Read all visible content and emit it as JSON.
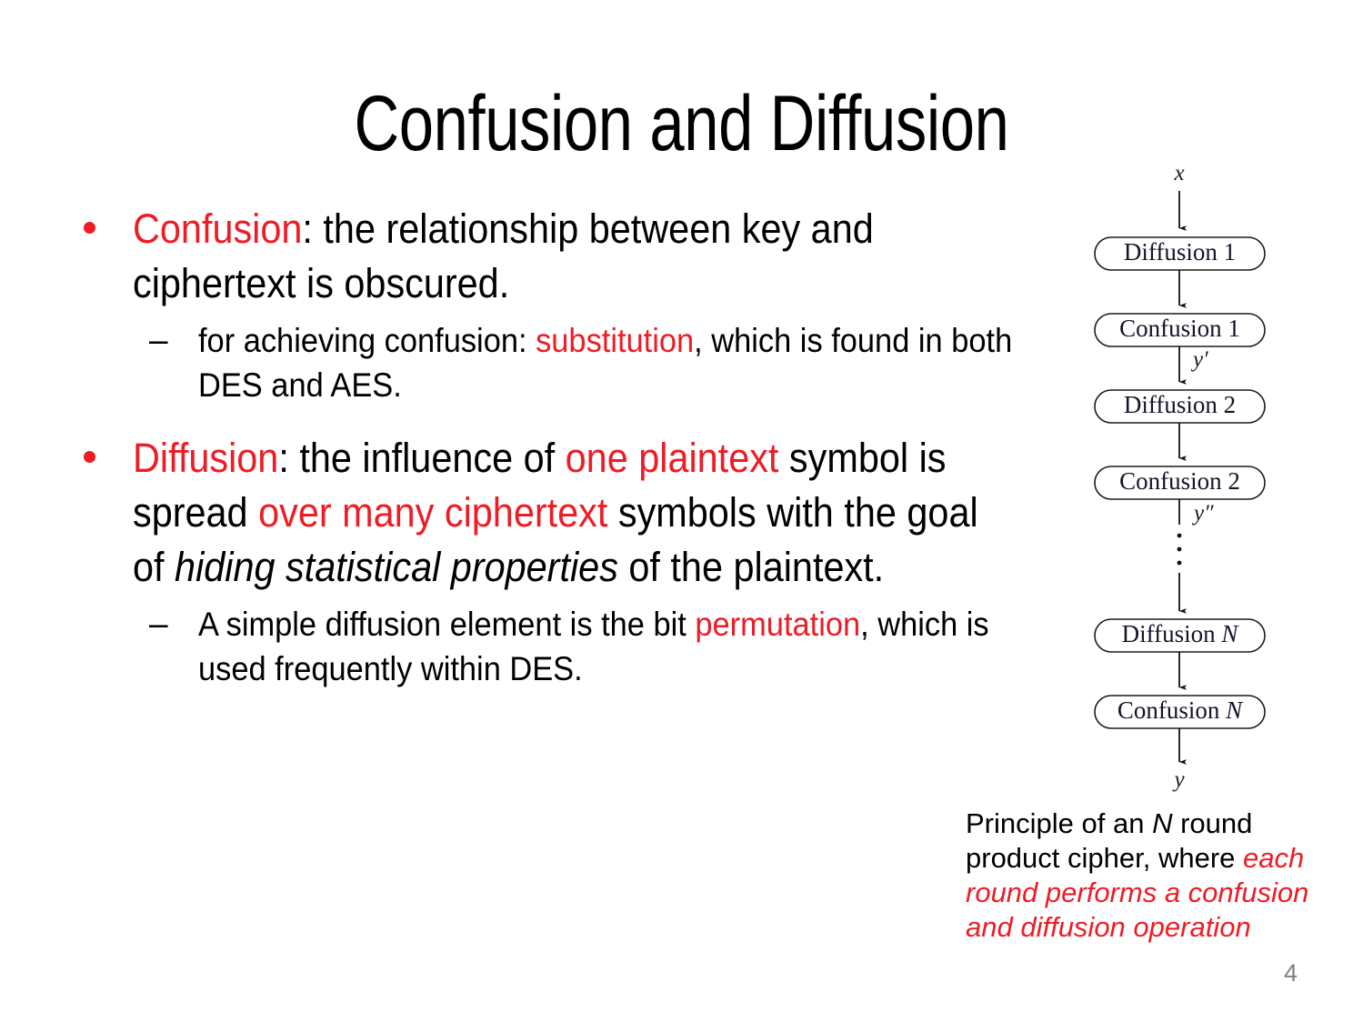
{
  "slide": {
    "title": "Confusion and Diffusion",
    "page_number": "4",
    "accent_red": "#ee1c25",
    "text_black": "#000000",
    "page_number_color": "#7f7f7f",
    "background": "#ffffff"
  },
  "body": {
    "bullet1": {
      "term": "Confusion",
      "rest": ": the relationship between key and ciphertext is obscured.",
      "sub": {
        "marker": "–",
        "pre": "for achieving confusion: ",
        "highlight": "substitution",
        "post": ", which is found in both DES and AES."
      }
    },
    "bullet2": {
      "term": "Diffusion",
      "part1": ": the influence of ",
      "highlight1": "one plaintext",
      "part2": " symbol is spread ",
      "highlight2": "over many ciphertext",
      "part3": " symbols with the goal of ",
      "italic1": "hiding statistical properties",
      "part4": " of the plaintext.",
      "sub": {
        "marker": "–",
        "pre": "A simple diffusion element is the bit ",
        "highlight": "permutation",
        "post": ", which is used frequently within DES."
      }
    }
  },
  "diagram": {
    "input_label": "x",
    "output_label": "y",
    "intermediate_label_1": "y′",
    "intermediate_label_2": "y″",
    "ellipsis": "⋮",
    "boxes": [
      {
        "text": "Diffusion 1",
        "name": "diffusion-1"
      },
      {
        "text": "Confusion 1",
        "name": "confusion-1"
      },
      {
        "text": "Diffusion 2",
        "name": "diffusion-2"
      },
      {
        "text": "Confusion 2",
        "name": "confusion-2"
      },
      {
        "text_plain": "Diffusion ",
        "text_italic": "N",
        "name": "diffusion-n"
      },
      {
        "text_plain": "Confusion ",
        "text_italic": "N",
        "name": "confusion-n"
      }
    ]
  },
  "caption": {
    "line_plain_1": "Principle of an ",
    "line_italic_n": "N",
    "line_plain_2": " round product cipher, where ",
    "line_red_italic": "each round performs a confusion and diffusion operation"
  }
}
